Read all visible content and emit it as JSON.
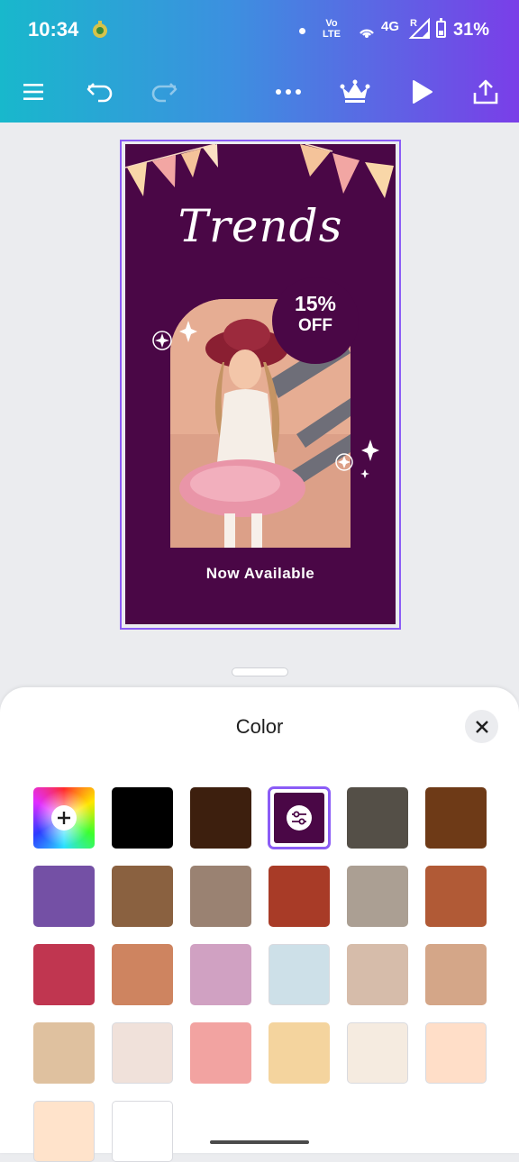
{
  "status_bar": {
    "time": "10:34",
    "volte_top": "Vo",
    "volte_bottom": "LTE",
    "network": "4G",
    "roaming": "R",
    "battery": "31%"
  },
  "toolbar": {
    "menu_icon": "hamburger-menu-icon",
    "undo_icon": "undo-icon",
    "redo_icon": "redo-icon",
    "more_icon": "more-options-icon",
    "premium_icon": "crown-icon",
    "play_icon": "play-icon",
    "share_icon": "share-upload-icon"
  },
  "design": {
    "title": "Trends",
    "badge_percent": "15%",
    "badge_text": "OFF",
    "cta": "Now Available",
    "background_color": "#4a0746"
  },
  "color_panel": {
    "heading": "Color",
    "close_icon": "close-icon",
    "add_color_icon": "plus-icon",
    "selected_swatch_icon": "sliders-adjust-icon",
    "selected_color": "#4a0746",
    "swatches": [
      "#000000",
      "#3d1f0e",
      "#4a0746",
      "#544f47",
      "#6e3a17",
      "#7450a5",
      "#8a6140",
      "#9a8272",
      "#a83b27",
      "#ab9f93",
      "#b15a36",
      "#c03650",
      "#ce8460",
      "#d0a1c2",
      "#cde0e8",
      "#d6bcaa",
      "#d4a688",
      "#dfc19f",
      "#f0e1da",
      "#f2a3a1",
      "#f4d49e",
      "#f5ebe0",
      "#ffdec8",
      "#ffe3cb",
      "#ffffff"
    ]
  }
}
